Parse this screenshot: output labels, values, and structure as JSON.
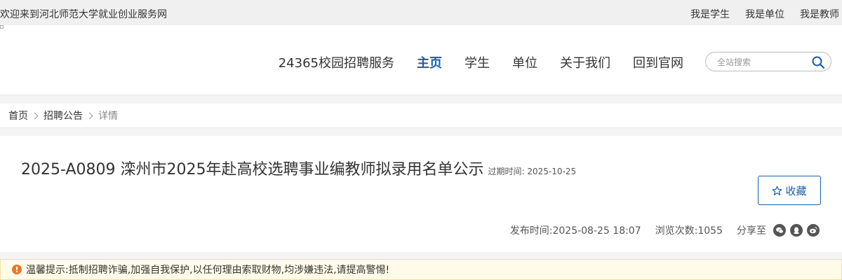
{
  "topbar": {
    "welcome": "欢迎来到河北师范大学就业创业服务网",
    "links": [
      "我是学生",
      "我是单位",
      "我是教师"
    ]
  },
  "nav": {
    "items": [
      "24365校园招聘服务",
      "主页",
      "学生",
      "单位",
      "关于我们",
      "回到官网"
    ],
    "active": "主页"
  },
  "search": {
    "placeholder": "全站搜索",
    "value": "",
    "icon": "search-icon"
  },
  "breadcrumb": {
    "home": "首页",
    "section": "招聘公告",
    "current": "详情"
  },
  "article": {
    "title": "2025-A0809 滦州市2025年赴高校选聘事业编教师拟录用名单公示",
    "expire_label": "过期时间:",
    "expire_date": "2025-10-25",
    "favorite_label": "收藏",
    "publish_label": "发布时间:",
    "publish_time": "2025-08-25 18:07",
    "views_label": "浏览次数:",
    "views": "1055",
    "share_label": "分享至",
    "share_icons": [
      "wechat-icon",
      "qq-icon",
      "weibo-icon"
    ]
  },
  "notice": {
    "text": "温馨提示:抵制招聘诈骗,加强自我保护,以任何理由索取财物,均涉嫌违法,请提高警惕!"
  },
  "colors": {
    "accent": "#1a5fa8",
    "warning": "#e8772e",
    "notice_bg": "#fffbe8"
  }
}
